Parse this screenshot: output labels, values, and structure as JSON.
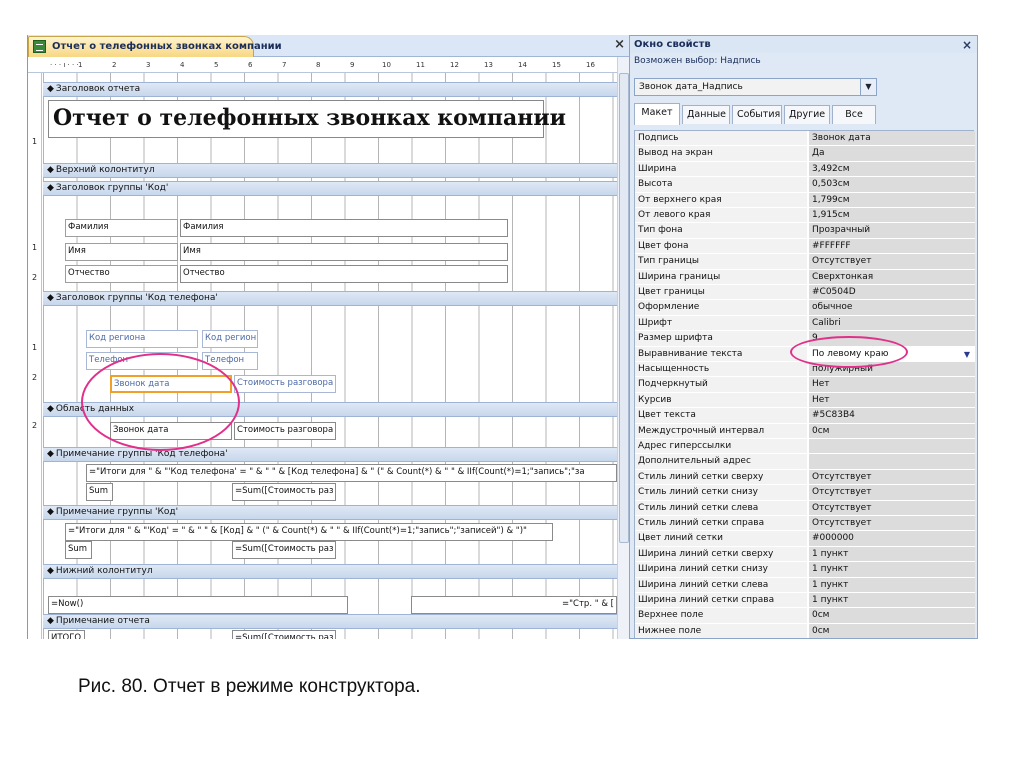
{
  "designer": {
    "tab_title": "Отчет о телефонных звонках компании",
    "close_glyph": "×",
    "ruler_marks": [
      "1",
      "2",
      "3",
      "4",
      "5",
      "6",
      "7",
      "8",
      "9",
      "10",
      "11",
      "12",
      "13",
      "14",
      "15",
      "16"
    ],
    "vruler_marks": [
      "1",
      "2",
      "1",
      "2",
      "1",
      "2"
    ],
    "bands": {
      "report_header": "Заголовок отчета",
      "page_header": "Верхний колонтитул",
      "group_code": "Заголовок группы 'Код'",
      "group_phone": "Заголовок группы 'Код телефона'",
      "detail": "Область данных",
      "phone_footer": "Примечание группы 'Код телефона'",
      "code_footer": "Примечание группы 'Код'",
      "page_footer": "Нижний колонтитул",
      "report_footer": "Примечание отчета"
    },
    "report_title": "Отчет о телефонных звонках компании",
    "group_code_controls": {
      "lastname_label": "Фамилия",
      "lastname_field": "Фамилия",
      "name_label": "Имя",
      "name_field": "Имя",
      "patronymic_label": "Отчество",
      "patronymic_field": "Отчество"
    },
    "group_phone_controls": {
      "region_label": "Код региона",
      "region_field": "Код регион",
      "phone_label": "Телефон",
      "phone_field": "Телефон",
      "date_label": "Звонок дата",
      "cost_label": "Стоимость разговора"
    },
    "detail_controls": {
      "date_field": "Звонок дата",
      "cost_field": "Стоимость разговора"
    },
    "phone_footer_controls": {
      "expr": "=\"Итоги для \" & \"'Код телефона' = \" & \" \" & [Код телефона] & \" (\" & Count(*) & \" \" & IIf(Count(*)=1;\"запись\";\"за",
      "sum_label": "Sum",
      "sum_field": "=Sum([Стоимость раз"
    },
    "code_footer_controls": {
      "expr": "=\"Итоги для \" & \"'Код' = \" & \" \" & [Код] & \" (\" & Count(*) & \" \" & IIf(Count(*)=1;\"запись\";\"записей\") & \")\"",
      "sum_label": "Sum",
      "sum_field": "=Sum([Стоимость раз"
    },
    "page_footer_controls": {
      "now_field": "=Now()",
      "page_field": "=\"Стр. \" & ["
    },
    "report_footer_controls": {
      "total_label": "ИТОГО",
      "sum_field": "=Sum([Стоимость раз"
    }
  },
  "props": {
    "title": "Окно свойств",
    "close_glyph": "×",
    "selection_type": "Возможен выбор:  Надпись",
    "selected_object": "Звонок дата_Надпись",
    "tabs": [
      "Макет",
      "Данные",
      "События",
      "Другие",
      "Все"
    ],
    "rows": [
      {
        "name": "Подпись",
        "value": "Звонок дата"
      },
      {
        "name": "Вывод на экран",
        "value": "Да"
      },
      {
        "name": "Ширина",
        "value": "3,492см"
      },
      {
        "name": "Высота",
        "value": "0,503см"
      },
      {
        "name": "От верхнего края",
        "value": "1,799см"
      },
      {
        "name": "От левого края",
        "value": "1,915см"
      },
      {
        "name": "Тип фона",
        "value": "Прозрачный"
      },
      {
        "name": "Цвет фона",
        "value": "#FFFFFF"
      },
      {
        "name": "Тип границы",
        "value": "Отсутствует"
      },
      {
        "name": "Ширина границы",
        "value": "Сверхтонкая"
      },
      {
        "name": "Цвет границы",
        "value": "#C0504D"
      },
      {
        "name": "Оформление",
        "value": "обычное"
      },
      {
        "name": "Шрифт",
        "value": "Calibri"
      },
      {
        "name": "Размер шрифта",
        "value": "9"
      },
      {
        "name": "Выравнивание текста",
        "value": "По левому краю"
      },
      {
        "name": "Насыщенность",
        "value": "полужирный"
      },
      {
        "name": "Подчеркнутый",
        "value": "Нет"
      },
      {
        "name": "Курсив",
        "value": "Нет"
      },
      {
        "name": "Цвет текста",
        "value": "#5C83B4"
      },
      {
        "name": "Междустрочный интервал",
        "value": "0см"
      },
      {
        "name": "Адрес гиперссылки",
        "value": ""
      },
      {
        "name": "Дополнительный адрес",
        "value": ""
      },
      {
        "name": "Стиль линий сетки сверху",
        "value": "Отсутствует"
      },
      {
        "name": "Стиль линий сетки снизу",
        "value": "Отсутствует"
      },
      {
        "name": "Стиль линий сетки слева",
        "value": "Отсутствует"
      },
      {
        "name": "Стиль линий сетки справа",
        "value": "Отсутствует"
      },
      {
        "name": "Цвет линий сетки",
        "value": "#000000"
      },
      {
        "name": "Ширина линий сетки сверху",
        "value": "1 пункт"
      },
      {
        "name": "Ширина линий сетки снизу",
        "value": "1 пункт"
      },
      {
        "name": "Ширина линий сетки слева",
        "value": "1 пункт"
      },
      {
        "name": "Ширина линий сетки справа",
        "value": "1 пункт"
      },
      {
        "name": "Верхнее поле",
        "value": "0см"
      },
      {
        "name": "Нижнее поле",
        "value": "0см"
      }
    ],
    "dropdown_glyph": "▼"
  },
  "caption": "Рис. 80. Отчет в режиме конструктора.",
  "colors": {
    "highlight": "#e0308a",
    "selection": "#f0a028",
    "band": "#c7d7ec"
  }
}
